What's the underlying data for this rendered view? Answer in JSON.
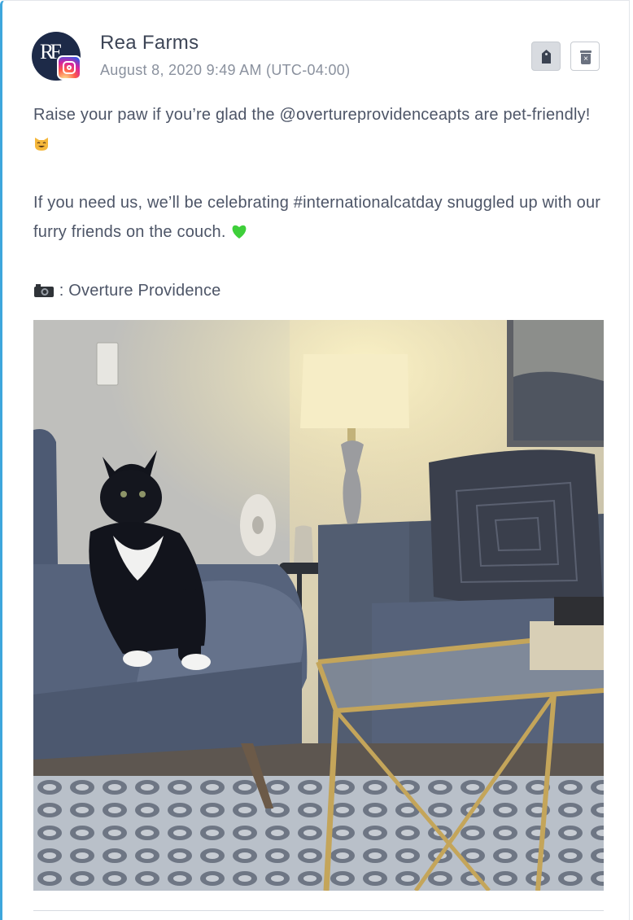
{
  "post": {
    "account_name": "Rea Farms",
    "avatar_monogram": "RF",
    "network": "instagram",
    "timestamp": "August 8, 2020 9:49 AM (UTC-04:00)",
    "paragraph_1": "Raise your paw if you’re glad the @overtureprovidenceapts are pet-friendly!",
    "paragraph_2": "If you need us, we’ll be celebrating #internationalcatday snuggled up with our furry friends on the couch.",
    "paragraph_3": ": Overture Providence",
    "emoji_1": "smiling-cat-emoji",
    "emoji_2": "green-heart-emoji",
    "emoji_3": "camera-emoji",
    "photo_subject": "tuxedo-cat-on-sofa-photo"
  },
  "actions": {
    "tag_icon": "tag-icon",
    "delete_icon": "trash-icon"
  },
  "colors": {
    "accent_border": "#3ea6dc",
    "text": "#4d5567",
    "muted": "#8a919e",
    "avatar_bg": "#1d2a48"
  }
}
